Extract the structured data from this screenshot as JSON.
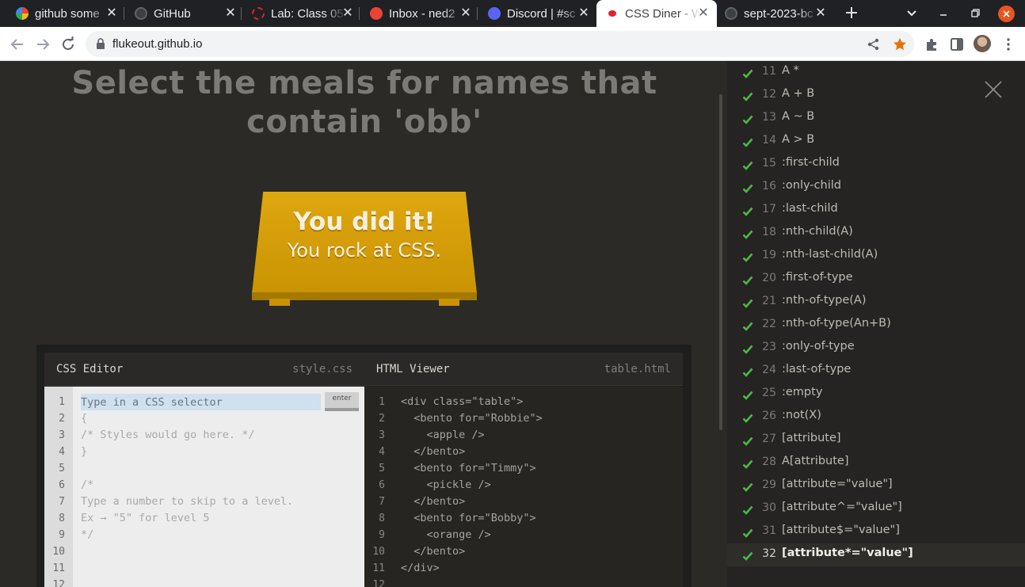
{
  "browser": {
    "tabs": [
      {
        "label": "github some",
        "favicon": "google-icon",
        "color": "#4285f4"
      },
      {
        "label": "GitHub",
        "favicon": "github-icon",
        "color": "#e8eaed"
      },
      {
        "label": "Lab: Class 05",
        "favicon": "canvas-icon",
        "color": "#e4202e"
      },
      {
        "label": "Inbox - ned2",
        "favicon": "gmail-icon",
        "color": "#ea4335"
      },
      {
        "label": "Discord | #sc",
        "favicon": "discord-icon",
        "color": "#5865f2"
      },
      {
        "label": "CSS Diner - W",
        "favicon": "css-diner-icon",
        "color": "#e4202e"
      },
      {
        "label": "sept-2023-bc",
        "favicon": "github-icon",
        "color": "#e8eaed"
      }
    ],
    "active_tab": 5,
    "url": "flukeout.github.io",
    "new_tab": "+"
  },
  "page": {
    "order": "Select the meals for names that contain 'obb'",
    "win_title": "You did it!",
    "win_subtitle": "You rock at CSS."
  },
  "css_editor": {
    "title": "CSS Editor",
    "file": "style.css",
    "placeholder": "Type in a CSS selector",
    "enter_label": "enter",
    "lines": [
      "",
      "{",
      "/* Styles would go here. */",
      "}",
      "",
      "/*",
      "Type a number to skip to a level.",
      "Ex → \"5\" for level 5",
      "*/",
      "",
      "",
      ""
    ],
    "line_numbers": [
      "1",
      "2",
      "3",
      "4",
      "5",
      "6",
      "7",
      "8",
      "9",
      "10",
      "11",
      "12"
    ]
  },
  "html_viewer": {
    "title": "HTML Viewer",
    "file": "table.html",
    "lines": [
      "<div class=\"table\">",
      "  <bento for=\"Robbie\">",
      "    <apple />",
      "  </bento>",
      "  <bento for=\"Timmy\">",
      "    <pickle />",
      "  </bento>",
      "  <bento for=\"Bobby\">",
      "    <orange />",
      "  </bento>",
      "</div>",
      ""
    ],
    "line_numbers": [
      "1",
      "2",
      "3",
      "4",
      "5",
      "6",
      "7",
      "8",
      "9",
      "10",
      "11",
      "12"
    ]
  },
  "levels": {
    "current": "32",
    "check_color": "#4cb944",
    "items": [
      {
        "num": "11",
        "name": "A *"
      },
      {
        "num": "12",
        "name": "A + B"
      },
      {
        "num": "13",
        "name": "A ~ B"
      },
      {
        "num": "14",
        "name": "A > B"
      },
      {
        "num": "15",
        "name": ":first-child"
      },
      {
        "num": "16",
        "name": ":only-child"
      },
      {
        "num": "17",
        "name": ":last-child"
      },
      {
        "num": "18",
        "name": ":nth-child(A)"
      },
      {
        "num": "19",
        "name": ":nth-last-child(A)"
      },
      {
        "num": "20",
        "name": ":first-of-type"
      },
      {
        "num": "21",
        "name": ":nth-of-type(A)"
      },
      {
        "num": "22",
        "name": ":nth-of-type(An+B)"
      },
      {
        "num": "23",
        "name": ":only-of-type"
      },
      {
        "num": "24",
        "name": ":last-of-type"
      },
      {
        "num": "25",
        "name": ":empty"
      },
      {
        "num": "26",
        "name": ":not(X)"
      },
      {
        "num": "27",
        "name": "[attribute]"
      },
      {
        "num": "28",
        "name": "A[attribute]"
      },
      {
        "num": "29",
        "name": "[attribute=\"value\"]"
      },
      {
        "num": "30",
        "name": "[attribute^=\"value\"]"
      },
      {
        "num": "31",
        "name": "[attribute$=\"value\"]"
      },
      {
        "num": "32",
        "name": "[attribute*=\"value\"]"
      }
    ]
  }
}
